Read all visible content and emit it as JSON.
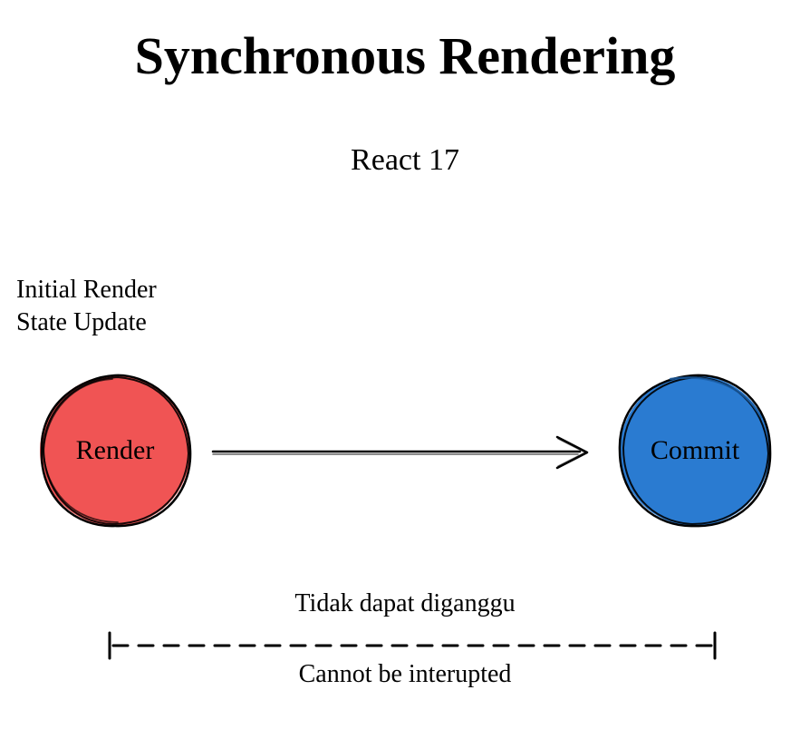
{
  "title": "Synchronous Rendering",
  "subtitle": "React 17",
  "triggers": {
    "line1": "Initial Render",
    "line2": "State Update"
  },
  "nodes": {
    "render": {
      "label": "Render",
      "fill": "#f05454",
      "stroke": "#000000"
    },
    "commit": {
      "label": "Commit",
      "fill": "#2a7bd1",
      "stroke": "#000000"
    }
  },
  "captions": {
    "top": "Tidak dapat diganggu",
    "bottom": "Cannot be interupted"
  }
}
